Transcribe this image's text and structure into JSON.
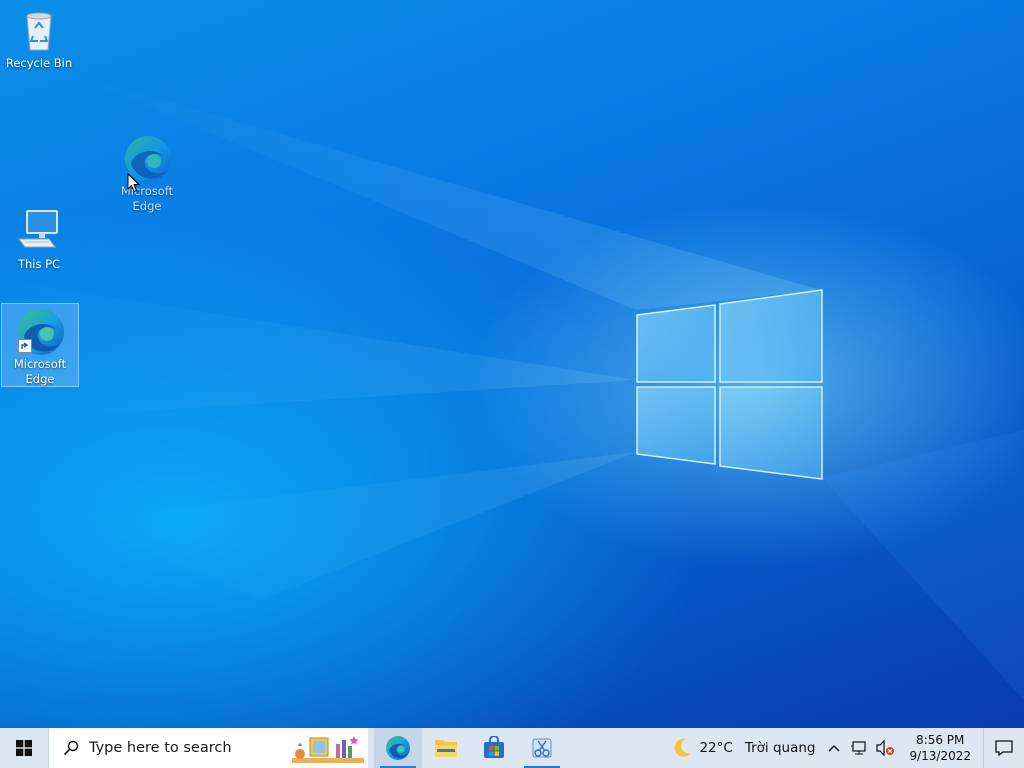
{
  "desktop": {
    "icons": [
      {
        "label": "Recycle Bin",
        "icon": "recycle-bin-icon"
      },
      {
        "label": "Microsoft Edge",
        "icon": "edge-icon",
        "state": "dragging"
      },
      {
        "label": "This PC",
        "icon": "this-pc-icon"
      },
      {
        "label": "Microsoft Edge",
        "icon": "edge-icon",
        "state": "selected"
      }
    ]
  },
  "taskbar": {
    "start_icon": "windows-logo-icon",
    "search": {
      "placeholder": "Type here to search"
    },
    "apps": [
      {
        "name": "Microsoft Edge",
        "icon": "edge-icon",
        "active": true
      },
      {
        "name": "File Explorer",
        "icon": "folder-icon"
      },
      {
        "name": "Microsoft Store",
        "icon": "store-icon"
      },
      {
        "name": "Snipping tool / paint",
        "icon": "snip-icon",
        "running": true
      }
    ],
    "weather": {
      "temp": "22°C",
      "condition": "Trời quang",
      "icon": "moon-icon"
    },
    "tray": {
      "icons": [
        "chevron-up-icon",
        "network-icon",
        "volume-muted-icon"
      ],
      "time": "8:56 PM",
      "date": "9/13/2022"
    },
    "notification_icon": "notification-icon"
  },
  "colors": {
    "accent": "#2a7ad6",
    "taskbar": "#dde7f2",
    "desktop": "#0a6fdc"
  }
}
